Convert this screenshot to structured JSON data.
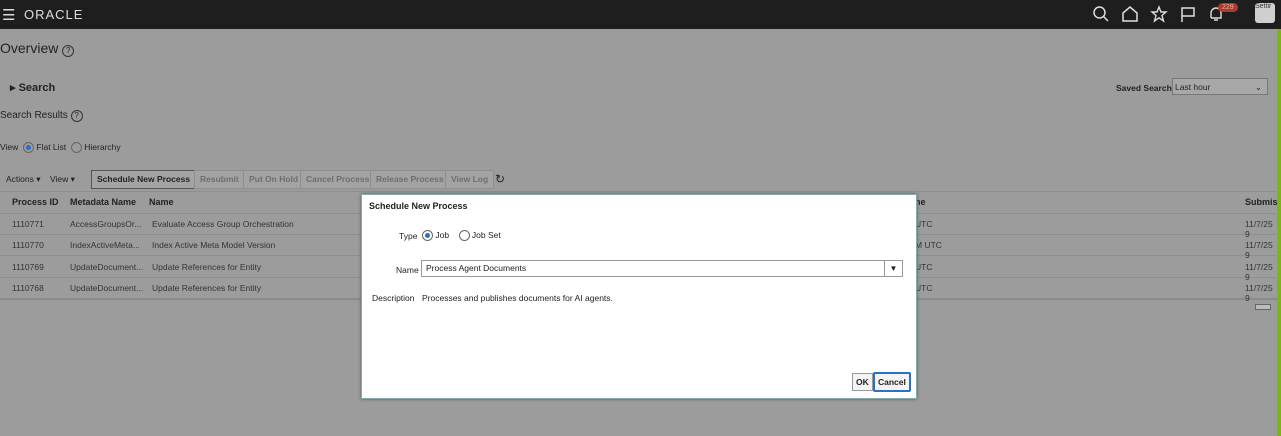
{
  "header": {
    "brand": "ORACLE",
    "notification_count": "229",
    "user": "Settir"
  },
  "page": {
    "title": "Overview",
    "search_label": "Search",
    "saved_search_label": "Saved Search",
    "saved_search_value": "Last hour",
    "results_label": "Search Results",
    "view_label": "View",
    "flat_list": "Flat List",
    "hierarchy": "Hierarchy"
  },
  "toolbar": {
    "actions": "Actions",
    "view": "View",
    "schedule": "Schedule New Process",
    "resubmit": "Resubmit",
    "hold": "Put On Hold",
    "cancel": "Cancel Process",
    "release": "Release Process",
    "log": "View Log"
  },
  "table": {
    "headers": [
      "Process ID",
      "Metadata Name",
      "Name",
      "ne",
      "Submis"
    ],
    "rows": [
      {
        "id": "1110771",
        "meta": "AccessGroupsOr...",
        "name": "Evaluate Access Group Orchestration",
        "time": "UTC",
        "sub": "11/7/25 9"
      },
      {
        "id": "1110770",
        "meta": "IndexActiveMeta...",
        "name": "Index Active Meta Model Version",
        "time": "M UTC",
        "sub": "11/7/25 9"
      },
      {
        "id": "1110769",
        "meta": "UpdateDocument...",
        "name": "Update References for Entity",
        "time": "UTC",
        "sub": "11/7/25 9"
      },
      {
        "id": "1110768",
        "meta": "UpdateDocument...",
        "name": "Update References for Entity",
        "time": "UTC",
        "sub": "11/7/25 9"
      }
    ]
  },
  "modal": {
    "title": "Schedule New Process",
    "type_label": "Type",
    "job": "Job",
    "job_set": "Job Set",
    "name_label": "Name",
    "name_value": "Process Agent Documents",
    "desc_label": "Description",
    "desc_value": "Processes and publishes documents for AI agents.",
    "ok": "OK",
    "cancel": "Cancel"
  }
}
